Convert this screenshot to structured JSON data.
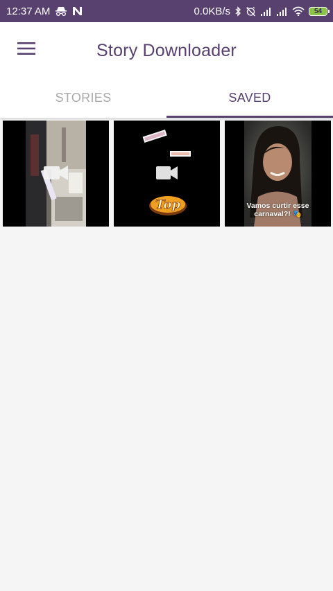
{
  "status_bar": {
    "time": "12:37 AM",
    "net_speed": "0.0KB/s",
    "battery": "54",
    "icons": [
      "incognito-icon",
      "n-app-icon",
      "bluetooth-icon",
      "alarm-off-icon",
      "signal-icon",
      "signal-icon",
      "wifi-icon",
      "battery-icon"
    ]
  },
  "app_bar": {
    "title": "Story Downloader",
    "menu_icon": "hamburger-menu-icon"
  },
  "tabs": [
    {
      "label": "STORIES",
      "active": false
    },
    {
      "label": "SAVED",
      "active": true
    }
  ],
  "colors": {
    "primary": "#58406f",
    "tab_inactive": "#a9a9a9",
    "background": "#f5f5f5"
  },
  "saved_items": [
    {
      "type": "video",
      "icon": "video-camera-icon"
    },
    {
      "type": "video",
      "icon": "video-camera-icon",
      "sticker_text": "Top"
    },
    {
      "type": "image",
      "caption_line1": "Vamos curtir esse",
      "caption_line2": "carnaval?! 🎭"
    }
  ]
}
